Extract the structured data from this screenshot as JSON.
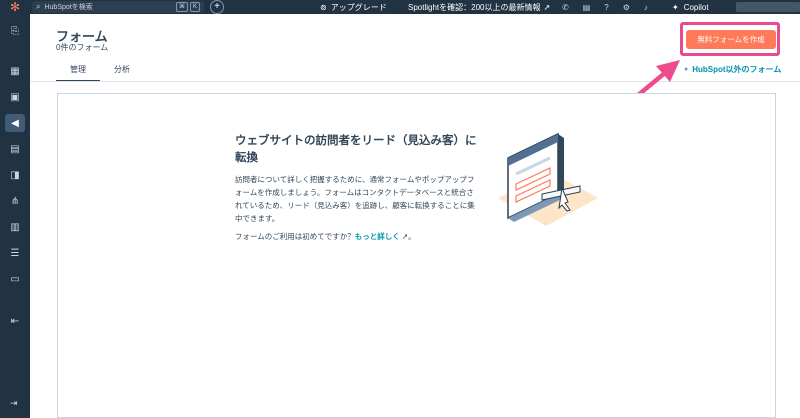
{
  "topbar": {
    "logo_glyph": "✻",
    "search_placeholder": "HubSpotを検索",
    "search_shortcut_keys": [
      "⌘",
      "K"
    ],
    "create_glyph": "+",
    "upgrade_label": "アップグレード",
    "spotlight_label": "Spotlightを確認：200以上の最新情報",
    "copilot_label": "Copilot",
    "icons": [
      "phone-icon",
      "marketplace-icon",
      "help-icon",
      "settings-icon",
      "notifications-icon"
    ]
  },
  "sidebar": {
    "icons": [
      "bookmark-icon",
      "dashboard-icon",
      "contacts-icon",
      "marketing-icon",
      "content-icon",
      "commerce-icon",
      "automation-icon",
      "reporting-icon",
      "data-icon",
      "library-icon",
      "collapse-icon"
    ],
    "active": "marketing-icon"
  },
  "header": {
    "title": "フォーム",
    "count": "0件のフォーム",
    "tabs": [
      "管理",
      "分析"
    ],
    "active_tab": "管理",
    "create_button": "無料フォームを作成",
    "external_link": "HubSpot以外のフォーム"
  },
  "empty_state": {
    "title": "ウェブサイトの訪問者をリード（見込み客）に転換",
    "description": "訪問者について詳しく把握するために、通常フォームやポップアップフォームを作成しましょう。フォームはコンタクトデータベースと統合されているため、リード（見込み客）を追跡し、顧客に転換することに集中できます。",
    "help_prefix": "フォームのご利用は初めてですか？",
    "help_link": "もっと詳しく",
    "help_suffix": "。"
  },
  "colors": {
    "topbar": "#213343",
    "accent_button": "#ff7a59",
    "highlight": "#e8498f",
    "link": "#0091ae"
  }
}
